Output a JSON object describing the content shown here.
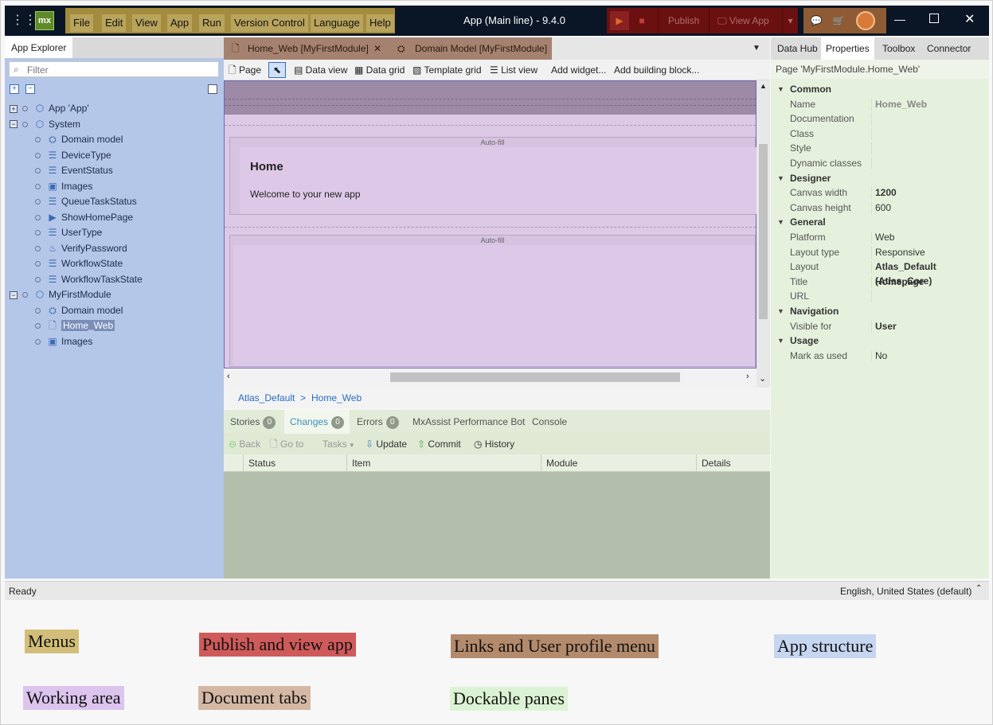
{
  "titlebar": {
    "logo": "mx",
    "menus": [
      "File",
      "Edit",
      "View",
      "App",
      "Run",
      "Version Control",
      "Language",
      "Help"
    ],
    "app_title": "App (Main line)  -  9.4.0",
    "run_icon": "play-icon",
    "stop_icon": "stop-icon",
    "publish": "Publish",
    "view_app": "View App",
    "colors": {
      "menus": "#b9a45d",
      "publish_area": "#6a1010",
      "links_area": "#8e5b35"
    }
  },
  "explorer": {
    "tab": "App Explorer",
    "filter_placeholder": "Filter",
    "tree": [
      {
        "label": "App 'App'",
        "level": 0,
        "toggle": "+",
        "icon": "cube-icon"
      },
      {
        "label": "System",
        "level": 0,
        "toggle": "-",
        "icon": "module-icon"
      },
      {
        "label": "Domain model",
        "level": 1,
        "icon": "domain-model-icon"
      },
      {
        "label": "DeviceType",
        "level": 1,
        "icon": "enumeration-icon"
      },
      {
        "label": "EventStatus",
        "level": 1,
        "icon": "enumeration-icon"
      },
      {
        "label": "Images",
        "level": 1,
        "icon": "images-icon"
      },
      {
        "label": "QueueTaskStatus",
        "level": 1,
        "icon": "enumeration-icon"
      },
      {
        "label": "ShowHomePage",
        "level": 1,
        "icon": "microflow-icon"
      },
      {
        "label": "UserType",
        "level": 1,
        "icon": "enumeration-icon"
      },
      {
        "label": "VerifyPassword",
        "level": 1,
        "icon": "java-action-icon"
      },
      {
        "label": "WorkflowState",
        "level": 1,
        "icon": "enumeration-icon"
      },
      {
        "label": "WorkflowTaskState",
        "level": 1,
        "icon": "enumeration-icon"
      },
      {
        "label": "MyFirstModule",
        "level": 0,
        "toggle": "-",
        "icon": "module-icon"
      },
      {
        "label": "Domain model",
        "level": 1,
        "icon": "domain-model-icon"
      },
      {
        "label": "Home_Web",
        "level": 1,
        "icon": "page-icon",
        "selected": true
      },
      {
        "label": "Images",
        "level": 1,
        "icon": "images-icon"
      }
    ]
  },
  "doc_tabs": [
    "Home_Web [MyFirstModule]",
    "Domain Model [MyFirstModule]"
  ],
  "page_toolbar": [
    "Page",
    "Data view",
    "Data grid",
    "Template grid",
    "List view",
    "Add widget...",
    "Add building block..."
  ],
  "canvas": {
    "autofill_1": "Auto-fill",
    "autofill_2": "Auto-fill",
    "heading": "Home",
    "text": "Welcome to your new app"
  },
  "breadcrumb": {
    "layout": "Atlas_Default",
    "sep": ">",
    "page": "Home_Web"
  },
  "bottom": {
    "tabs": [
      {
        "label": "Stories",
        "count": "0"
      },
      {
        "label": "Changes",
        "count": "0",
        "active": true
      },
      {
        "label": "Errors",
        "count": "0"
      },
      {
        "label": "MxAssist Performance Bot"
      },
      {
        "label": "Console"
      }
    ],
    "toolbar": [
      "Back",
      "Go to",
      "Tasks",
      "Update",
      "Commit",
      "History"
    ],
    "columns": [
      "Status",
      "Item",
      "Module",
      "Details"
    ]
  },
  "right": {
    "tabs": [
      "Data Hub",
      "Properties",
      "Toolbox",
      "Connector"
    ],
    "header": "Page 'MyFirstModule.Home_Web'",
    "rows": [
      {
        "section": "Common"
      },
      {
        "key": "Name",
        "value": "Home_Web",
        "style": "g"
      },
      {
        "key": "Documentation",
        "value": ""
      },
      {
        "key": "Class",
        "value": ""
      },
      {
        "key": "Style",
        "value": ""
      },
      {
        "key": "Dynamic classes",
        "value": ""
      },
      {
        "section": "Designer"
      },
      {
        "key": "Canvas width",
        "value": "1200",
        "style": "b"
      },
      {
        "key": "Canvas height",
        "value": "600"
      },
      {
        "section": "General"
      },
      {
        "key": "Platform",
        "value": "Web"
      },
      {
        "key": "Layout type",
        "value": "Responsive"
      },
      {
        "key": "Layout",
        "value": "Atlas_Default (Atlas_Core)",
        "style": "b"
      },
      {
        "key": "Title",
        "value": "Homepage",
        "style": "b"
      },
      {
        "key": "URL",
        "value": ""
      },
      {
        "section": "Navigation"
      },
      {
        "key": "Visible for",
        "value": "User",
        "style": "b"
      },
      {
        "section": "Usage"
      },
      {
        "key": "Mark as used",
        "value": "No"
      }
    ]
  },
  "status": {
    "left": "Ready",
    "right": "English, United States (default)"
  },
  "legend": [
    {
      "label": "Menus",
      "color": "#d2be78"
    },
    {
      "label": "Publish and view app",
      "color": "#cf5a5a"
    },
    {
      "label": "Links and User profile menu",
      "color": "#b38a6c"
    },
    {
      "label": "App structure",
      "color": "#c6d6f0"
    },
    {
      "label": "Working area",
      "color": "#dcc4ee"
    },
    {
      "label": "Document tabs",
      "color": "#d4b8a4"
    },
    {
      "label": "Dockable panes",
      "color": "#dcf2d4"
    }
  ]
}
